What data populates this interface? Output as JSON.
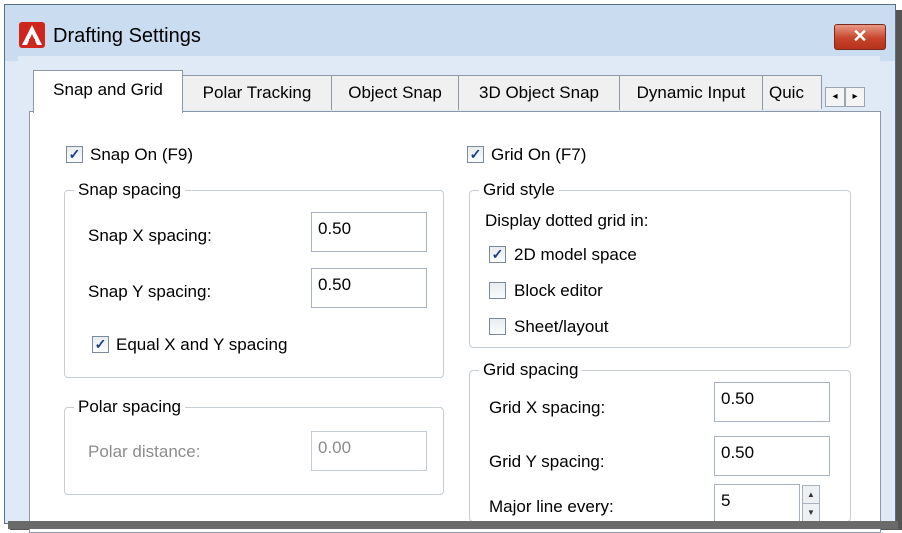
{
  "window": {
    "title": "Drafting Settings",
    "close_symbol": "✕"
  },
  "tabs": [
    {
      "label": "Snap and Grid",
      "active": true
    },
    {
      "label": "Polar Tracking"
    },
    {
      "label": "Object Snap"
    },
    {
      "label": "3D Object Snap"
    },
    {
      "label": "Dynamic Input"
    },
    {
      "label": "Quic"
    }
  ],
  "tab_scroll": {
    "left": "◂",
    "right": "▸"
  },
  "snap": {
    "snap_on_label": "Snap On (F9)",
    "snap_on_checked": true,
    "spacing_title": "Snap spacing",
    "x_label": "Snap X spacing:",
    "x_value": "0.50",
    "y_label": "Snap Y spacing:",
    "y_value": "0.50",
    "equal_label": "Equal X and Y spacing",
    "equal_checked": true,
    "polar_title": "Polar spacing",
    "polar_label": "Polar distance:",
    "polar_value": "0.00"
  },
  "grid": {
    "grid_on_label": "Grid On (F7)",
    "grid_on_checked": true,
    "style_title": "Grid style",
    "display_label": "Display dotted grid in:",
    "options": [
      {
        "label": "2D model space",
        "checked": true
      },
      {
        "label": "Block editor",
        "checked": false
      },
      {
        "label": "Sheet/layout",
        "checked": false
      }
    ],
    "spacing_title": "Grid spacing",
    "x_label": "Grid X spacing:",
    "x_value": "0.50",
    "y_label": "Grid Y spacing:",
    "y_value": "0.50",
    "major_label": "Major line every:",
    "major_value": "5"
  },
  "check_mark": "✓",
  "spin": {
    "up": "▲",
    "down": "▼"
  }
}
